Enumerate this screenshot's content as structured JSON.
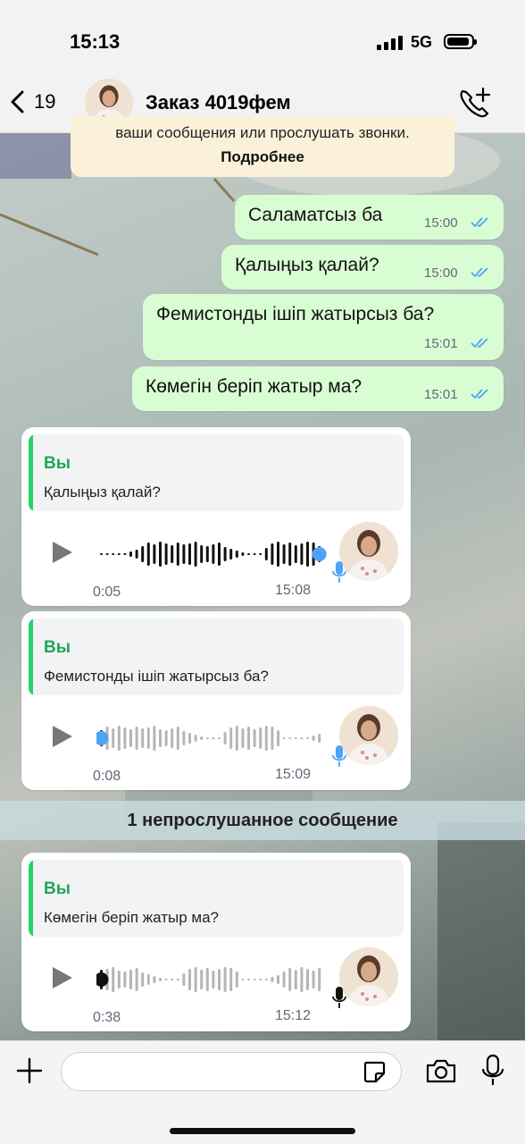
{
  "status": {
    "time": "15:13",
    "network": "5G"
  },
  "header": {
    "back_count": "19",
    "title": "Заказ 4019фем"
  },
  "notice": {
    "text": "ваши сообщения или прослушать звонки.",
    "more": "Подробнее"
  },
  "messages": [
    {
      "text": "Саламатсыз ба",
      "time": "15:00"
    },
    {
      "text": "Қалыңыз қалай?",
      "time": "15:00"
    },
    {
      "text": "Фемистонды ішіп жатырсыз ба?",
      "time": "15:01"
    },
    {
      "text": "Көмегін беріп жатыр ма?",
      "time": "15:01"
    }
  ],
  "voice_replies": [
    {
      "quote_author": "Вы",
      "quote_text": "Қалыңыз қалай?",
      "duration": "0:05",
      "time": "15:08",
      "progress": 1.0,
      "played": true
    },
    {
      "quote_author": "Вы",
      "quote_text": "Фемистонды ішіп жатырсыз ба?",
      "duration": "0:08",
      "time": "15:09",
      "progress": 0.0,
      "played": true
    },
    {
      "quote_author": "Вы",
      "quote_text": "Көмегін беріп жатыр ма?",
      "duration": "0:38",
      "time": "15:12",
      "progress": 0.0,
      "played": false
    }
  ],
  "unread_banner": "1 непрослушанное сообщение",
  "input": {
    "placeholder": ""
  },
  "colors": {
    "outgoing_bubble": "#d9fdd3",
    "tick_read": "#4fa3f7",
    "quote_bar": "#25d366",
    "played_dot": "#4fa3f7"
  }
}
